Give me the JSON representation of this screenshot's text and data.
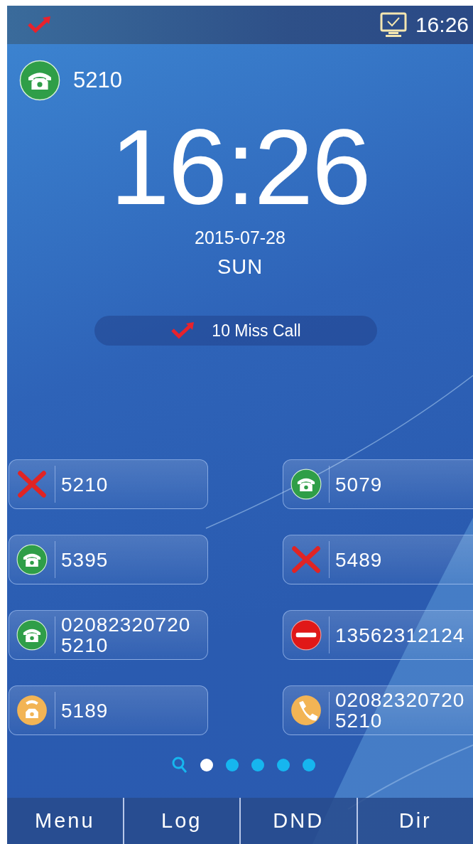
{
  "status_bar": {
    "time": "16:26"
  },
  "account": {
    "number": "5210"
  },
  "clock": {
    "time": "16:26",
    "date": "2015-07-28",
    "weekday": "SUN"
  },
  "notice": {
    "text": "10 Miss Call"
  },
  "speed_dials": [
    {
      "kind": "missed",
      "lines": [
        "5210"
      ]
    },
    {
      "kind": "phone",
      "lines": [
        "5079"
      ]
    },
    {
      "kind": "phone",
      "lines": [
        "5395"
      ]
    },
    {
      "kind": "missed",
      "lines": [
        "5489"
      ]
    },
    {
      "kind": "phone",
      "lines": [
        "02082320720",
        "5210"
      ]
    },
    {
      "kind": "blocked",
      "lines": [
        "13562312124"
      ]
    },
    {
      "kind": "ringing",
      "lines": [
        "5189"
      ]
    },
    {
      "kind": "handset",
      "lines": [
        "02082320720",
        "5210"
      ]
    }
  ],
  "pages": [
    {
      "kind": "search",
      "selected": false
    },
    {
      "kind": "dot",
      "selected": true
    },
    {
      "kind": "dot",
      "selected": false
    },
    {
      "kind": "dot",
      "selected": false
    },
    {
      "kind": "dot",
      "selected": false
    },
    {
      "kind": "dot",
      "selected": false
    }
  ],
  "softkeys": [
    "Menu",
    "Log",
    "DND",
    "Dir"
  ]
}
